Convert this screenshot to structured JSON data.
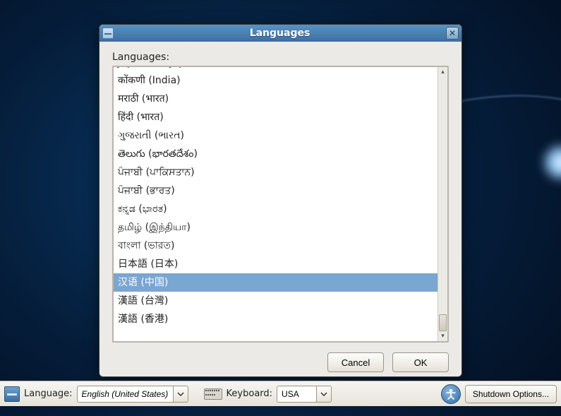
{
  "dialog": {
    "title": "Languages",
    "label": "Languages:",
    "cut_item": "Japanese (Japan)",
    "items": [
      "कोंकणी (India)",
      "मराठी (भारत)",
      "हिंदी (भारत)",
      "ગુજરાતી (ભારત)",
      "తెలుగు (భారతదేశం)",
      "ਪੰਜਾਬੀ (ਪਾਕਿਸਤਾਨ)",
      "ਪੰਜਾਬੀ (ਭਾਰਤ)",
      "ಕನ್ನಡ (ಭಾರತ)",
      "தமிழ் (இந்தியா)",
      "বাংলা (ভারত)",
      "日本語 (日本)",
      "汉语 (中国)",
      "漢語 (台灣)",
      "漢語 (香港)"
    ],
    "selected_index": 11,
    "cancel": "Cancel",
    "ok": "OK"
  },
  "panel": {
    "language_label": "Language:",
    "language_value": "English (United States)",
    "keyboard_label": "Keyboard:",
    "keyboard_value": "USA",
    "shutdown": "Shutdown Options..."
  }
}
